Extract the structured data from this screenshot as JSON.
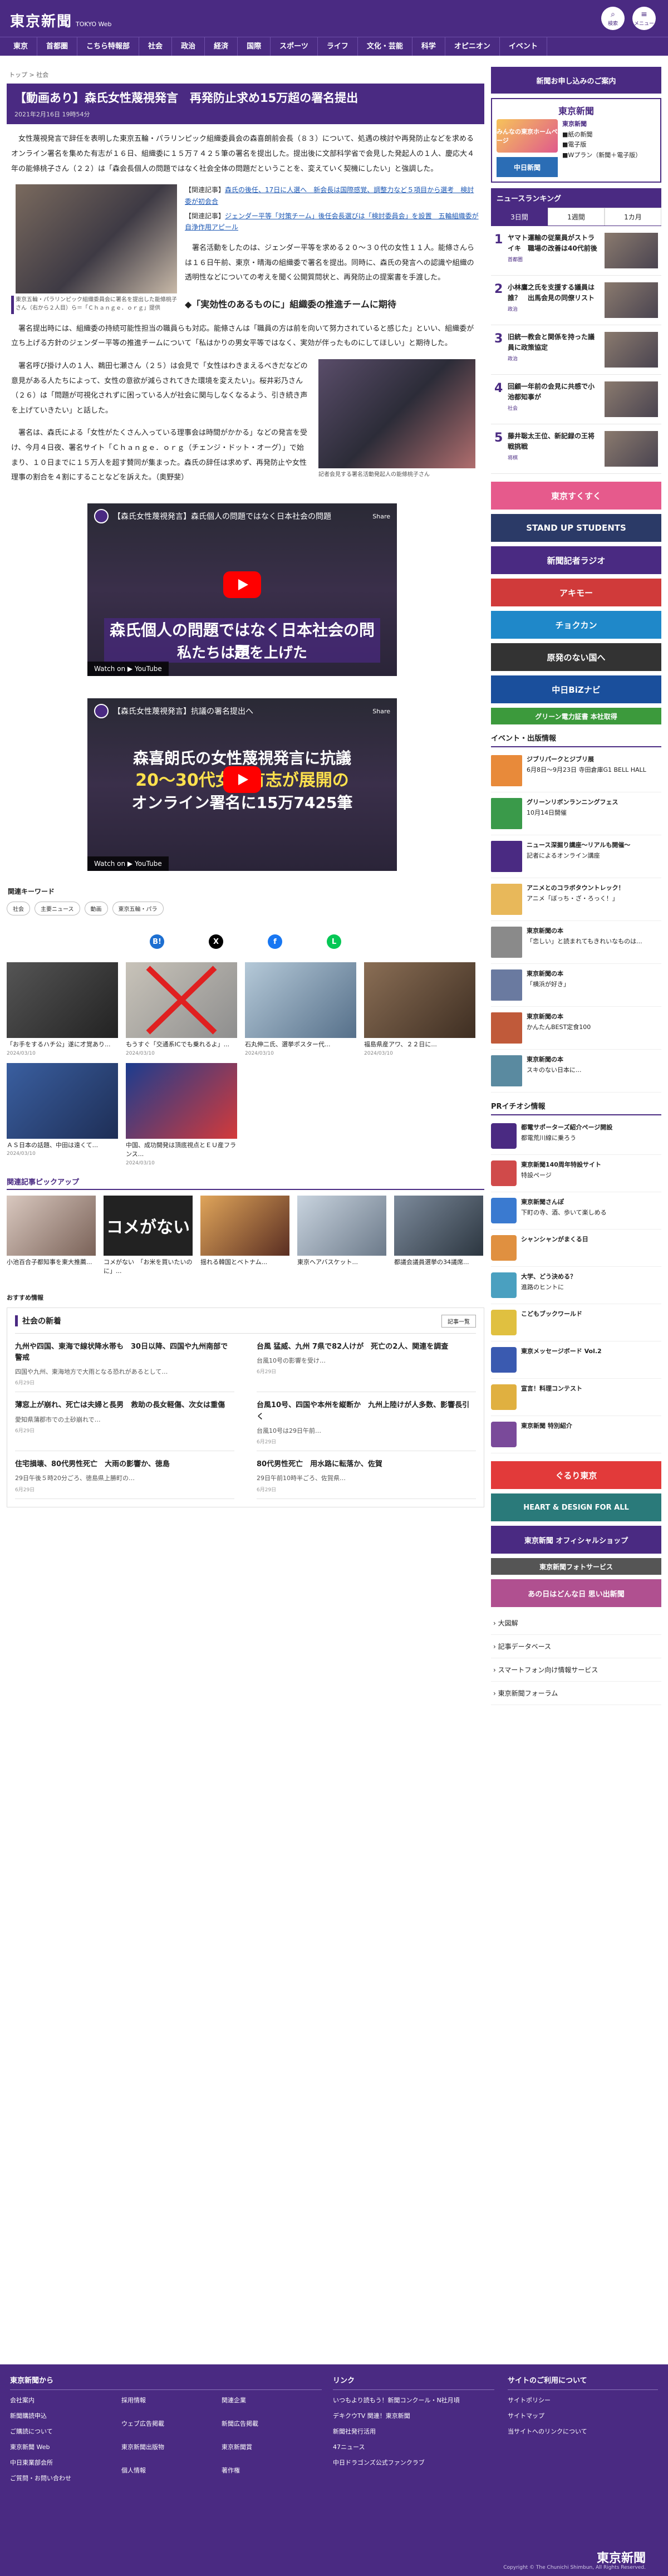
{
  "header": {
    "logo": "東京新聞",
    "logo_sub": "TOKYO Web",
    "btn_search": "検索",
    "btn_menu": "メニュー"
  },
  "gnav": [
    "東京",
    "首都圏",
    "こちら特報部",
    "社会",
    "政治",
    "経済",
    "国際",
    "スポーツ",
    "ライフ",
    "文化・芸能",
    "科学",
    "オピニオン",
    "イベント"
  ],
  "article": {
    "crumb": "トップ > 社会",
    "title": "【動画あり】森氏女性蔑視発言　再発防止求め15万超の署名提出",
    "date": "2021年2月16日 19時54分",
    "p1": "女性蔑視発言で辞任を表明した東京五輪・パラリンピック組織委員会の森喜朗前会長（８３）について、処遇の検討や再発防止などを求めるオンライン署名を集めた有志が１６日、組織委に１５万７４２５筆の署名を提出した。提出後に文部科学省で会見した発起人の１人、慶応大４年の能條桃子さん（２２）は「森会長個人の問題ではなく社会全体の問題だということを、変えていく契機にしたい」と強調した。",
    "photo_caption": "東京五輪・パラリンピック組織委員会に署名を提出した能條桃子さん（右から２人目）ら＝「Ｃｈａｎｇｅ．ｏｒｇ」提供",
    "rel1_tag": "【関連記事】",
    "rel1": "森氏の後任、17日に人選へ　新会長は国際感覚、調整力など５項目から選考　検討委が初会合",
    "rel2_tag": "【関連記事】",
    "rel2": "ジェンダー平等「対策チーム」後任会長選びは「検討委員会」を設置　五輪組織委が自浄作用アピール",
    "p2": "署名活動をしたのは、ジェンダー平等を求める２０～３０代の女性１１人。能條さんらは１６日午前、東京・晴海の組織委で署名を提出。同時に、森氏の発言への認識や組織の透明性などについての考えを聞く公開質問状と、再発防止の提案書を手渡した。",
    "h2": "◆「実効性のあるものに」組織委の推進チームに期待",
    "p3": "署名提出時には、組織委の持続可能性担当の職員らも対応。能條さんは「職員の方は前を向いて努力されていると感じた」といい、組織委が立ち上げる方針のジェンダー平等の推進チームについて「私はかりの男女平等ではなく、実効が伴ったものにしてほしい」と期待した。",
    "p4": "署名呼び掛け人の１人、鵜田七瀬さん（２５）は会見で「女性はわきまえるべきだなどの意見がある人たちによって、女性の意欲が減らされてきた環境を変えたい」。桜井彩乃さん（２６）は「問題が可視化されずに困っている人が社会に関与しなくなるよう、引き続き声を上げていきたい」と話した。",
    "photo2_caption": "記者会見する署名活動発起人の能條桃子さん",
    "p5": "署名は、森氏による「女性がたくさん入っている理事会は時間がかかる」などの発言を受け、今月４日夜、署名サイト「Ｃｈａｎｇｅ．ｏｒｇ（チェンジ・ドット・オーグ）」で始まり、１０日までに１５万人を超す賛同が集まった。森氏の辞任は求めず、再発防止や女性理事の割合を４割にすることなどを訴えた。（奥野斐）"
  },
  "videos": [
    {
      "title": "【森氏女性蔑視発言】森氏個人の問題ではなく日本社会の問題",
      "share": "Share",
      "cap1": "森氏個人の問題ではなく日本社会の問題",
      "cap2": "私たちは声を上げた",
      "watch": "Watch on ▶ YouTube"
    },
    {
      "title": "【森氏女性蔑視発言】抗議の署名提出へ",
      "share": "Share",
      "cap1": "森喜朗氏の女性蔑視発言に抗議",
      "cap2": "20～30代女性有志が展開の",
      "cap3": "オンライン署名に15万7425筆",
      "watch": "Watch on ▶ YouTube"
    }
  ],
  "keywords": {
    "title": "関連キーワード",
    "items": [
      "社会",
      "主要ニュース",
      "動画",
      "東京五輪・パラ"
    ]
  },
  "share_icons": [
    "B!",
    "X",
    "f",
    "L"
  ],
  "related": [
    {
      "t": "「お手をするハチ公」遂に才覚あり...",
      "d": "2024/03/10"
    },
    {
      "t": "もうすぐ「交通系ICでも乗れるよ」...",
      "d": "2024/03/10"
    },
    {
      "t": "石丸伸二氏、選挙ポスター代...",
      "d": "2024/03/10"
    },
    {
      "t": "福島県産アワ、２２日に...",
      "d": "2024/03/10"
    },
    {
      "t": "ＡＳ日本の話題、中田は遠くて...",
      "d": "2024/03/10"
    },
    {
      "t": "中国、成功開発は頂底視点とＥＵ産フランス...",
      "d": "2024/03/10"
    }
  ],
  "pickup": {
    "title": "関連記事ピックアップ",
    "items": [
      {
        "t": "小池百合子都知事を東大推薦...",
        "d": ""
      },
      {
        "t": "コメがない　「お米を買いたいのに」...",
        "d": ""
      },
      {
        "t": "揺れる韓国とベトナム...",
        "d": ""
      },
      {
        "t": "東京ヘアバスケット...",
        "d": ""
      },
      {
        "t": "都議会議員選挙の34議席...",
        "d": ""
      }
    ]
  },
  "osusume": "おすすめ情報",
  "news": {
    "title": "社会の新着",
    "more": "記事一覧",
    "items": [
      {
        "h": "九州や四国、東海で線状降水帯も　30日以降、四国や九州南部で警戒",
        "p": "四国や九州、東海地方で大雨となる恐れがあるとして…",
        "d": "6月29日"
      },
      {
        "h": "台風 猛威、九州 7県で82人けが　死亡の2人、関連を調査",
        "p": "台風10号の影響を受け…",
        "d": "6月29日"
      },
      {
        "h": "薄窓上が崩れ、死亡は夫婦と長男　救助の長女軽傷、次女は重傷",
        "p": "愛知県蒲郡市での土砂崩れで…",
        "d": "6月29日"
      },
      {
        "h": "台風10号、四国や本州を縦断か　九州上陸けが人多数、影響長引く",
        "p": "台風10号は29日午前…",
        "d": "6月29日"
      },
      {
        "h": "住宅損壊、80代男性死亡　大雨の影響か、徳島",
        "p": "29日午後５時20分ごろ、徳島県上勝町の…",
        "d": "6月29日"
      },
      {
        "h": "80代男性死亡　用水路に転落か、佐賀",
        "p": "29日午前10時半ごろ、佐賀県…",
        "d": "6月29日"
      }
    ]
  },
  "sidebar": {
    "top_banner": "新聞お申し込みのご案内",
    "promo_logo": "東京新聞",
    "promo_img": "みんなの東京ホームページ",
    "promo_img2": "東京新聞",
    "promo_lines": [
      "■紙の新聞",
      "■電子版",
      "■Wプラン（新聞＋電子版）"
    ],
    "promo_img3": "中日新聞",
    "ranking_title": "ニュースランキング",
    "tabs": [
      "3日間",
      "1週間",
      "1カ月"
    ],
    "ranking": [
      {
        "n": "1",
        "t": "ヤマト運輸の従業員がストライキ　職場の改善は40代前後",
        "tg": "首都圏"
      },
      {
        "n": "2",
        "t": "小林鷹之氏を支援する議員は誰？　出馬会見の同僚リスト",
        "tg": "政治"
      },
      {
        "n": "3",
        "t": "旧統一教会と関係を持った議員に政策協定",
        "tg": "政治"
      },
      {
        "n": "4",
        "t": "回顧一年前の会見に共感で小池都知事が",
        "tg": "社会"
      },
      {
        "n": "5",
        "t": "藤井聡太王位、新記録の王将戦挑戦",
        "tg": "将棋"
      }
    ],
    "banners": [
      {
        "t": "東京すくすく",
        "c": "#e65a8c"
      },
      {
        "t": "STAND UP STUDENTS",
        "c": "#2b3a67"
      },
      {
        "t": "新聞記者ラジオ",
        "c": "#4a2a82"
      },
      {
        "t": "アキモー",
        "c": "#d03a3a"
      },
      {
        "t": "チョクカン",
        "c": "#1f88c9"
      },
      {
        "t": "原発のない国へ",
        "c": "#333333"
      },
      {
        "t": "中日BiZナビ",
        "c": "#1a4f9c"
      },
      {
        "t": "グリーン電力証書 本社取得",
        "c": "#3c9a3c"
      }
    ],
    "events_title": "イベント・出版情報",
    "events": [
      {
        "b": "ジブリパークとジブリ展",
        "t": "6月8日〜9月23日 寺田倉庫G1 BELL HALL"
      },
      {
        "b": "グリーンリボンランニングフェス",
        "t": "10月14日開催"
      },
      {
        "b": "ニュース深掘り講座～リアルも開催～",
        "t": "記者によるオンライン講座"
      },
      {
        "b": "アニメとのコラボタウントレック！",
        "t": "アニメ「ぼっち・ざ・ろっく！」"
      },
      {
        "b": "東京新聞の本",
        "t": "「恋しい」と読まれてもきれいなものは..."
      },
      {
        "b": "東京新聞の本",
        "t": "「横浜が好き」"
      },
      {
        "b": "東京新聞の本",
        "t": "かんたんBEST定食100"
      },
      {
        "b": "東京新聞の本",
        "t": "スキのない日本に..."
      }
    ],
    "pr_title": "PRイチオシ情報",
    "prs": [
      {
        "b": "都電サポーターズ紹介ページ開設",
        "t": "都電荒川線に乗ろう"
      },
      {
        "b": "東京新聞140周年特設サイト",
        "t": "特設ページ"
      },
      {
        "b": "東京新聞さんぽ",
        "t": "下町の寺、酒、歩いて楽しめる"
      },
      {
        "b": "シャンシャンがまくる日",
        "t": ""
      },
      {
        "b": "大学、どう決める？",
        "t": "進路のヒントに"
      },
      {
        "b": "こどもブックワールド",
        "t": ""
      },
      {
        "b": "東京メッセージボード Vol.2",
        "t": ""
      },
      {
        "b": "宣言！料理コンテスト",
        "t": ""
      },
      {
        "b": "東京新聞 特別紹介",
        "t": ""
      }
    ],
    "bottom_banners": [
      {
        "t": "ぐるり東京",
        "c": "#e23a3a"
      },
      {
        "t": "HEART & DESIGN FOR ALL",
        "c": "#2a7a7a"
      },
      {
        "t": "東京新聞 オフィシャルショップ",
        "c": "#4a2a82"
      },
      {
        "t": "東京新聞フォトサービス",
        "c": "#555555"
      },
      {
        "t": "あの日はどんな日 思い出新聞",
        "c": "#b05090"
      }
    ],
    "links": [
      "› 大図解",
      "› 記事データベース",
      "› スマートフォン向け情報サービス",
      "› 東京新聞フォーラム"
    ]
  },
  "footer": {
    "col1_title": "東京新聞から",
    "col1": [
      "会社案内",
      "新聞購読申込",
      "ご購読について",
      "東京新聞 Web",
      "中日東業部会所",
      "ご質問・お問い合わせ"
    ],
    "col1b": [
      "採用情報",
      "ウェブ広告掲載",
      "東京新聞出版物",
      "個人情報"
    ],
    "col1c": [
      "関連企業",
      "新聞広告掲載",
      "東京新聞賞",
      "著作権"
    ],
    "col2_title": "リンク",
    "col2": [
      "いつもより読もう！新聞コンクール・N社月頃",
      "デキクウTV 関連！東京新聞",
      "新聞社発行活用",
      "47ニュース",
      "中日ドラゴンズ公式ファンクラブ"
    ],
    "col3_title": "サイトのご利用について",
    "col3": [
      "サイトポリシー",
      "サイトマップ",
      "当サイトへのリンクについて"
    ],
    "logo": "東京新聞",
    "copy": "Copyright © The Chunichi Shimbun, All Rights Reserved."
  }
}
